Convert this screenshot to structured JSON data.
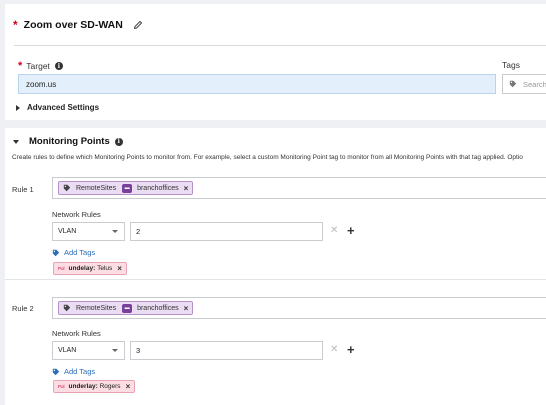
{
  "header": {
    "required_mark": "*",
    "title": "Zoom over SD-WAN"
  },
  "target": {
    "required_mark": "*",
    "label": "Target",
    "value": "zoom.us"
  },
  "tags": {
    "label": "Tags",
    "placeholder": "Search o"
  },
  "advanced": {
    "label": "Advanced Settings"
  },
  "monitoring": {
    "title": "Monitoring Points",
    "description": "Create rules to define which Monitoring Points to monitor from. For example, select a custom Monitoring Point tag to monitor from all Monitoring Points with that tag applied. Optio",
    "rules": [
      {
        "label": "Rule 1",
        "chip_left": "RemoteSites",
        "chip_right": "branchoffices",
        "network_rules_label": "Network Rules",
        "select_value": "VLAN",
        "input_value": "2",
        "add_tags_label": "Add Tags",
        "tag_prefix": "Pol",
        "tag_key": "undelay:",
        "tag_value": "Telus"
      },
      {
        "label": "Rule 2",
        "chip_left": "RemoteSites",
        "chip_right": "branchoffices",
        "network_rules_label": "Network Rules",
        "select_value": "VLAN",
        "input_value": "3",
        "add_tags_label": "Add Tags",
        "tag_prefix": "Pol",
        "tag_key": "underlay:",
        "tag_value": "Rogers"
      }
    ]
  },
  "glyphs": {
    "remove": "×",
    "clear": "✕",
    "add": "+",
    "info": "i",
    "separator": "▬"
  },
  "colors": {
    "required": "#d0021b",
    "target_bg": "#e3f0fb",
    "group_chip_bg": "#eadcf2",
    "group_chip_accent": "#7a3f9b",
    "tag_chip_bg": "#fbdde3",
    "link": "#2a6ebb"
  },
  "icons": [
    "pencil-icon",
    "info-icon",
    "tag-icon",
    "caret-down-icon",
    "clear-icon",
    "plus-icon"
  ]
}
